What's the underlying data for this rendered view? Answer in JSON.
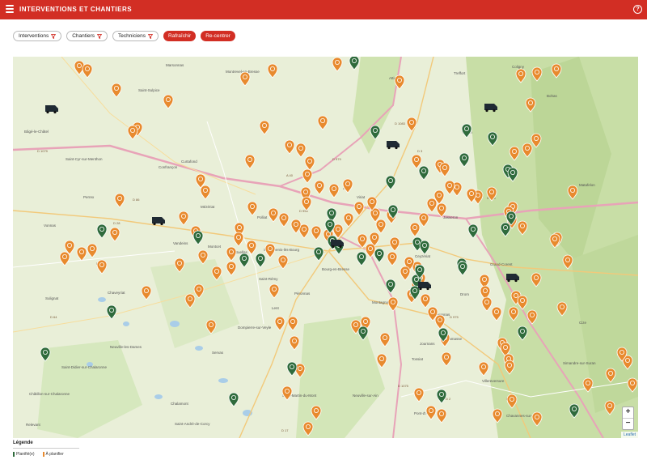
{
  "app": {
    "title": "INTERVENTIONS ET CHANTIERS",
    "help": "?"
  },
  "toolbar": {
    "filters": [
      "Interventions",
      "Chantiers",
      "Techniciens"
    ],
    "refresh": "Rafraîchir",
    "recenter": "Re-centrer"
  },
  "map": {
    "zoom_in": "+",
    "zoom_out": "−",
    "attribution": "Leaflet",
    "roads": [
      "A 40",
      "A 39",
      "D 1079",
      "D 1083",
      "D 936",
      "D 996",
      "D 1075",
      "D 975",
      "D 979",
      "D 3",
      "D 2",
      "D 91",
      "D 86",
      "D 28",
      "D 80",
      "D 17",
      "D 64"
    ],
    "places": [
      "Bâgé-le-Châtel",
      "Montrevel-en-Bresse",
      "Marsonnas",
      "Saint-Sulpice",
      "Curtafond",
      "Confrançon",
      "Vandeins",
      "Buellas",
      "Montcet",
      "Polliat",
      "Perrex",
      "Saint-Cyr-sur-Menthon",
      "Mézériat",
      "Vonnas",
      "Chaveyriat",
      "Saint-Rémy",
      "Servas",
      "Lent",
      "Dompierre-sur-Veyle",
      "Chalamont",
      "Tossiat",
      "Jasseron",
      "Ceyzériat",
      "Drom",
      "Ramasse",
      "Revonnas",
      "Journans",
      "Villereversure",
      "Simandre-sur-Suran",
      "Neuville-sur-Ain",
      "Pont-d'Ain",
      "Saint-Martin-du-Mont",
      "Attignat",
      "Treffort",
      "Coligny",
      "Verjon",
      "Viriat",
      "Péronnas",
      "Saint-Denis-lès-Bourg",
      "Bourg-en-Bresse",
      "Châtillon-sur-Chalaronne",
      "Neuville-les-Dames",
      "Saint-Didier-sur-Chalaronne",
      "Sulignat",
      "Relevant",
      "Saint-André-de-Corcy",
      "Grand-Corent",
      "Bohas",
      "Cize",
      "Matafelon",
      "Chavannes-sur-Suran",
      "Montagnat"
    ]
  },
  "legend": {
    "title": "Légende",
    "items": [
      {
        "label": "Planifié(e)",
        "color": "#2f6b3c"
      },
      {
        "label": "À planifier",
        "color": "#e88a2e"
      }
    ]
  },
  "colors": {
    "accent": "#d22e24",
    "planned": "#2f6b3c",
    "to_plan": "#e88a2e",
    "truck": "#1f2a33"
  }
}
